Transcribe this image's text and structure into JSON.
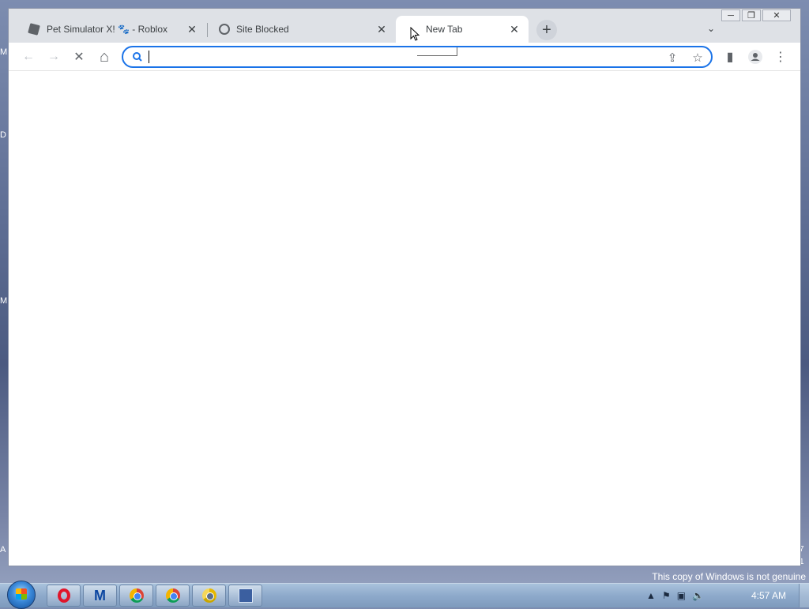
{
  "desktop": {
    "edge_letters": [
      "M",
      "D",
      "M",
      "A"
    ],
    "right_letters": [
      "7",
      "1"
    ]
  },
  "browser": {
    "tabs": [
      {
        "label": "Pet Simulator X! 🐾 - Roblox",
        "icon": "roblox-icon",
        "active": false
      },
      {
        "label": "Site Blocked",
        "icon": "globe-icon",
        "active": false
      },
      {
        "label": "New Tab",
        "icon": "loading-icon",
        "active": true
      }
    ],
    "new_tab_symbol": "+",
    "tab_search_symbol": "⌄",
    "window_controls": {
      "minimize": "─",
      "restore": "❐",
      "close": "✕"
    },
    "toolbar": {
      "back": "←",
      "forward": "→",
      "stop": "✕",
      "home": "⌂",
      "share": "⇪",
      "bookmark": "☆",
      "side_panel": "▮",
      "menu": "⋮"
    },
    "omnibox": {
      "value": "",
      "placeholder": ""
    }
  },
  "taskbar": {
    "apps": [
      "opera",
      "malwarebytes",
      "chrome",
      "chrome",
      "chrome-canary",
      "remote-desktop"
    ],
    "tray": {
      "arrow": "▲",
      "flag": "⚑",
      "network": "▣",
      "volume": "🔈"
    },
    "clock": "4:57 AM"
  },
  "watermark": "This copy of Windows is not genuine"
}
